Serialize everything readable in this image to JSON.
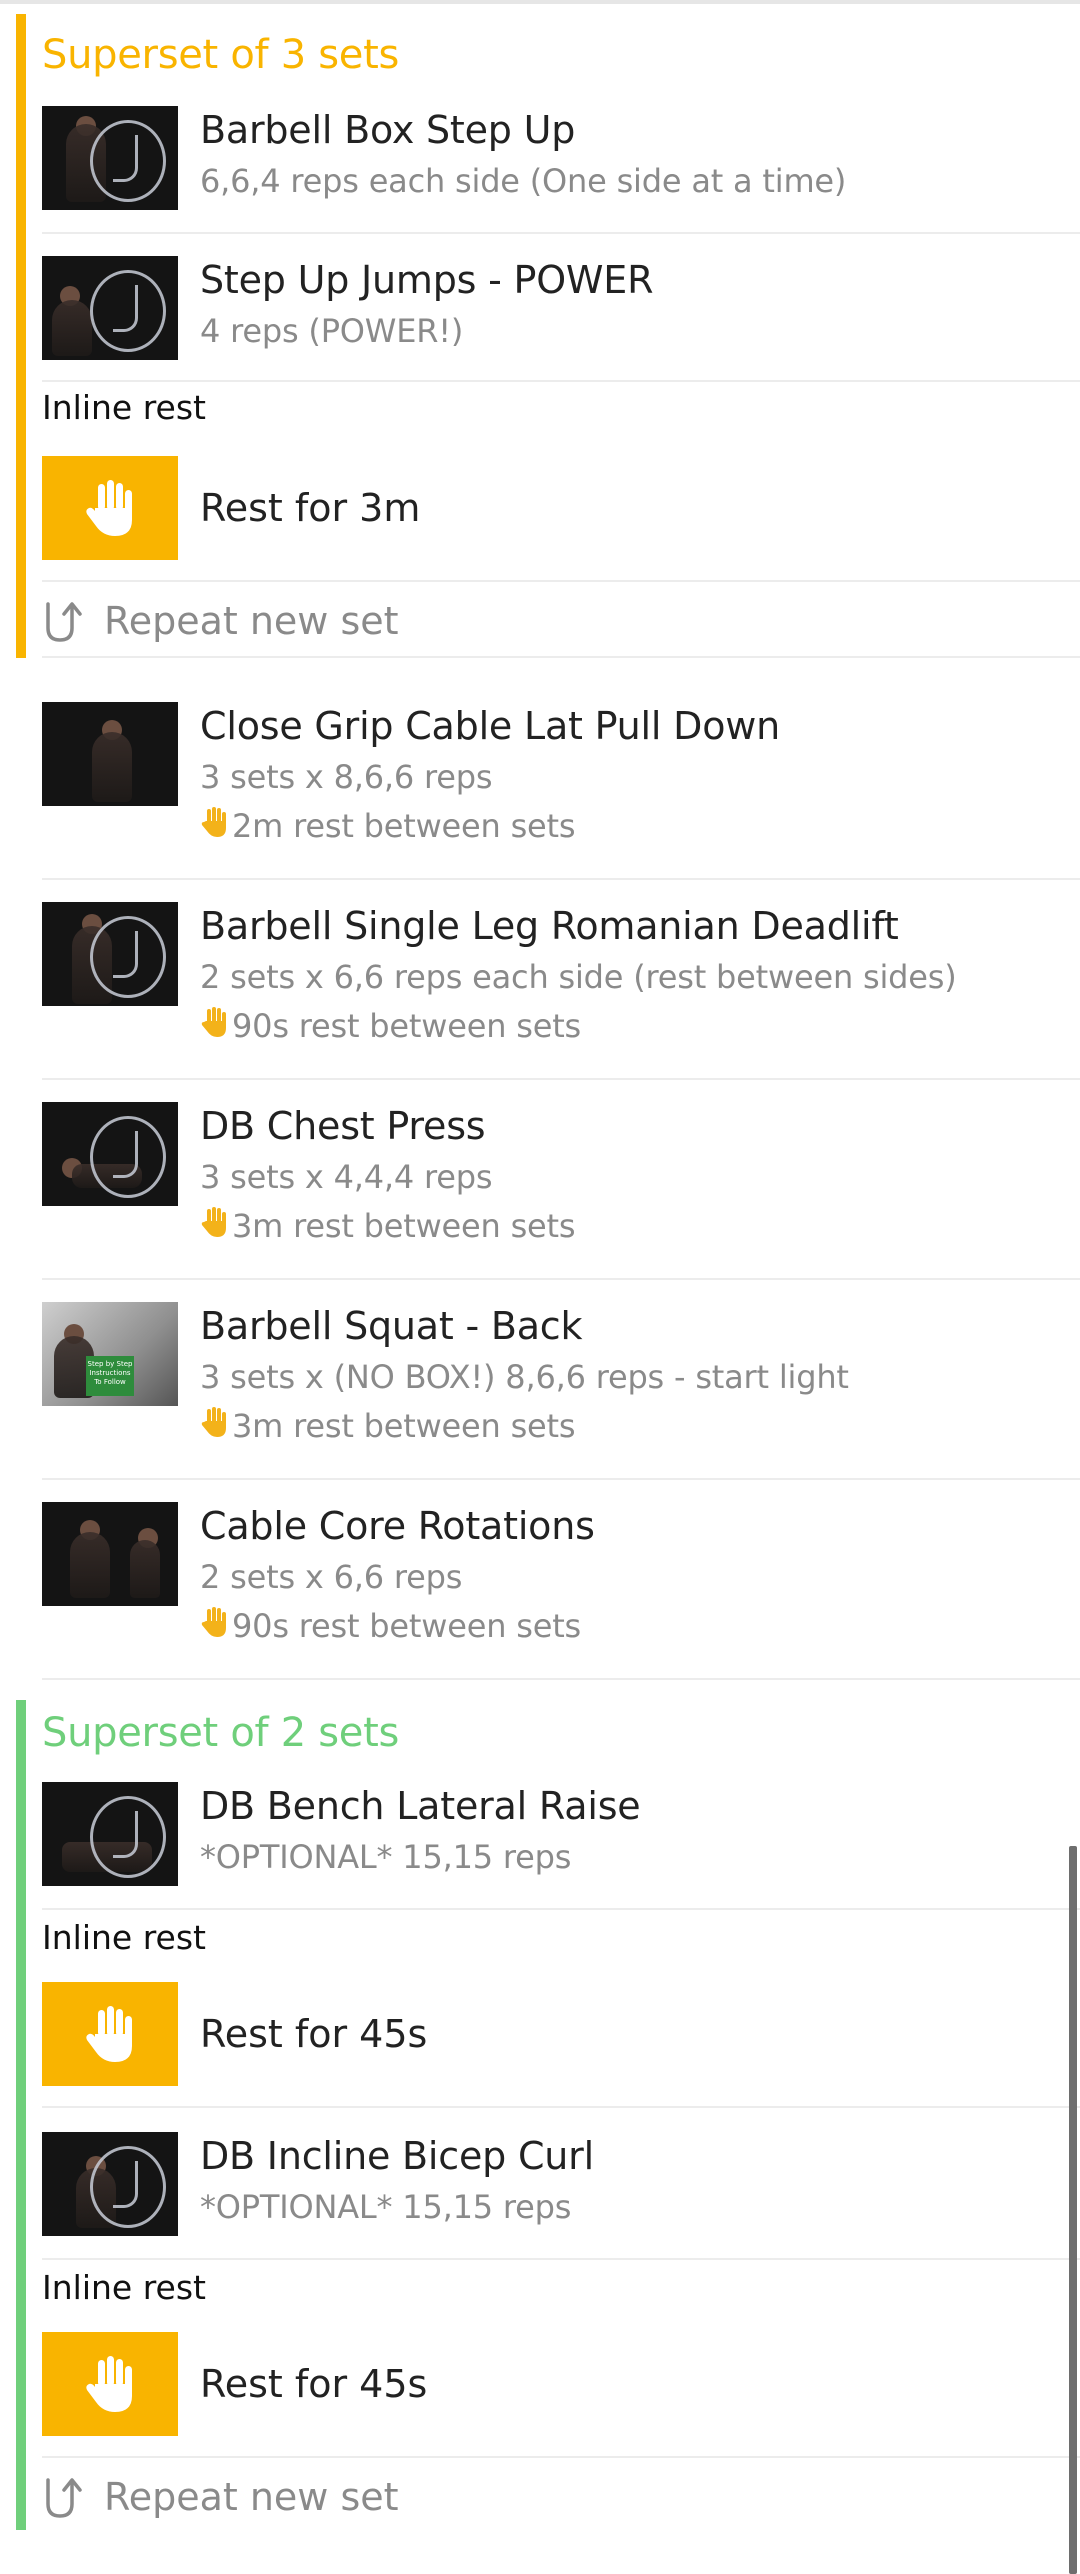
{
  "colors": {
    "superset_1": "#f9b400",
    "superset_2": "#6fcf7b",
    "rest_tile": "#f9b400",
    "muted_text": "#8a8a8a"
  },
  "superset_1": {
    "title": "Superset of 3 sets",
    "exercises": [
      {
        "name": "Barbell Box Step Up",
        "detail": "6,6,4 reps each side (One side at a time)"
      },
      {
        "name": "Step Up Jumps - POWER",
        "detail": "4 reps (POWER!)"
      }
    ],
    "inline_rest_label": "Inline rest",
    "rest": "Rest for 3m",
    "repeat": "Repeat new set"
  },
  "exercises": [
    {
      "name": "Close Grip Cable Lat Pull Down",
      "detail": "3 sets x 8,6,6 reps",
      "rest": "2m rest between sets"
    },
    {
      "name": "Barbell Single Leg Romanian Deadlift",
      "detail": "2 sets x 6,6 reps each side (rest between sides)",
      "rest": "90s rest between sets"
    },
    {
      "name": "DB Chest Press",
      "detail": "3 sets x 4,4,4 reps",
      "rest": "3m rest between sets"
    },
    {
      "name": "Barbell Squat - Back",
      "detail": "3 sets x (NO BOX!) 8,6,6 reps - start light",
      "rest": "3m rest between sets"
    },
    {
      "name": "Cable Core Rotations",
      "detail": "2 sets x 6,6 reps",
      "rest": "90s rest between sets"
    }
  ],
  "thumb_banner": "Step by Step Instructions To Follow",
  "superset_2": {
    "title": "Superset of 2 sets",
    "exercises": [
      {
        "name": "DB Bench Lateral Raise",
        "detail": "*OPTIONAL* 15,15 reps"
      },
      {
        "name": "DB Incline Bicep Curl",
        "detail": "*OPTIONAL* 15,15 reps"
      }
    ],
    "inline_rest_label": "Inline rest",
    "rests": [
      "Rest for 45s",
      "Rest for 45s"
    ],
    "repeat": "Repeat new set"
  },
  "icons": {
    "rest": "hand-icon",
    "repeat": "repeat-icon",
    "rest_between_sets": "hand-emoji-icon"
  }
}
